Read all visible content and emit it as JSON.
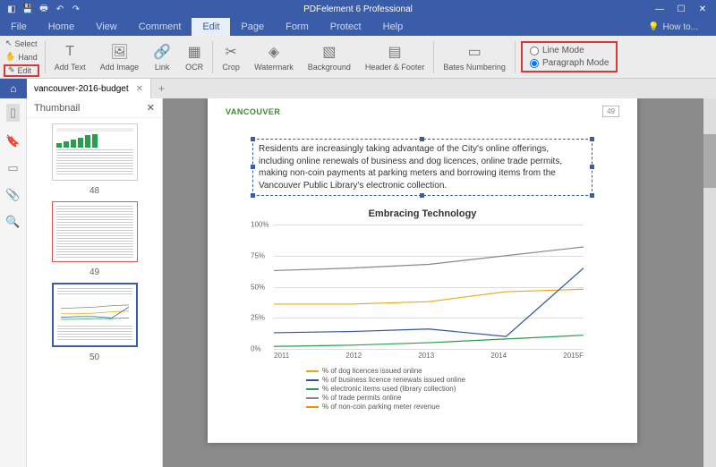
{
  "app_title": "PDFelement 6 Professional",
  "menu": {
    "file": "File",
    "home": "Home",
    "view": "View",
    "comment": "Comment",
    "edit": "Edit",
    "page": "Page",
    "form": "Form",
    "protect": "Protect",
    "help": "Help",
    "howto": "How to..."
  },
  "quicktools": {
    "select": "Select",
    "hand": "Hand",
    "edit": "Edit"
  },
  "ribbon": {
    "add_text": "Add Text",
    "add_image": "Add Image",
    "link": "Link",
    "ocr": "OCR",
    "crop": "Crop",
    "watermark": "Watermark",
    "background": "Background",
    "header_footer": "Header & Footer",
    "bates": "Bates Numbering"
  },
  "mode": {
    "line": "Line Mode",
    "para": "Paragraph Mode"
  },
  "tab_name": "vancouver-2016-budget",
  "thumbnail_title": "Thumbnail",
  "pages": {
    "p48": "48",
    "p49": "49",
    "p50": "50"
  },
  "doc": {
    "brand": "VANCOUVER",
    "page_number": "49",
    "paragraph": "Residents are increasingly taking advantage of the City's online offerings, including online renewals of business and dog licences, online trade permits, making non-coin payments at parking meters and borrowing items from the Vancouver Public Library's electronic collection."
  },
  "chart_data": {
    "type": "line",
    "title": "Embracing Technology",
    "xlabel": "",
    "ylabel": "",
    "categories": [
      "2011",
      "2012",
      "2013",
      "2014",
      "2015F"
    ],
    "yticks": [
      "0%",
      "25%",
      "50%",
      "75%",
      "100%"
    ],
    "ylim": [
      0,
      100
    ],
    "series": [
      {
        "name": "% of dog licences issued online",
        "color": "#e6a817",
        "values": [
          36,
          36,
          38,
          46,
          48
        ]
      },
      {
        "name": "% of business licence renewals issued online",
        "color": "#3054a5",
        "values": [
          13,
          14,
          16,
          10,
          65
        ]
      },
      {
        "name": "% electronic items used (library collection)",
        "color": "#2a9d4f",
        "values": [
          2,
          3,
          5,
          8,
          11
        ]
      },
      {
        "name": "% of trade permits online",
        "color": "#888888",
        "values": [
          63,
          65,
          68,
          75,
          82
        ]
      },
      {
        "name": "% of non-coin parking meter revenue",
        "color": "#ff8c00",
        "values": [
          null,
          null,
          null,
          null,
          null
        ]
      }
    ]
  }
}
